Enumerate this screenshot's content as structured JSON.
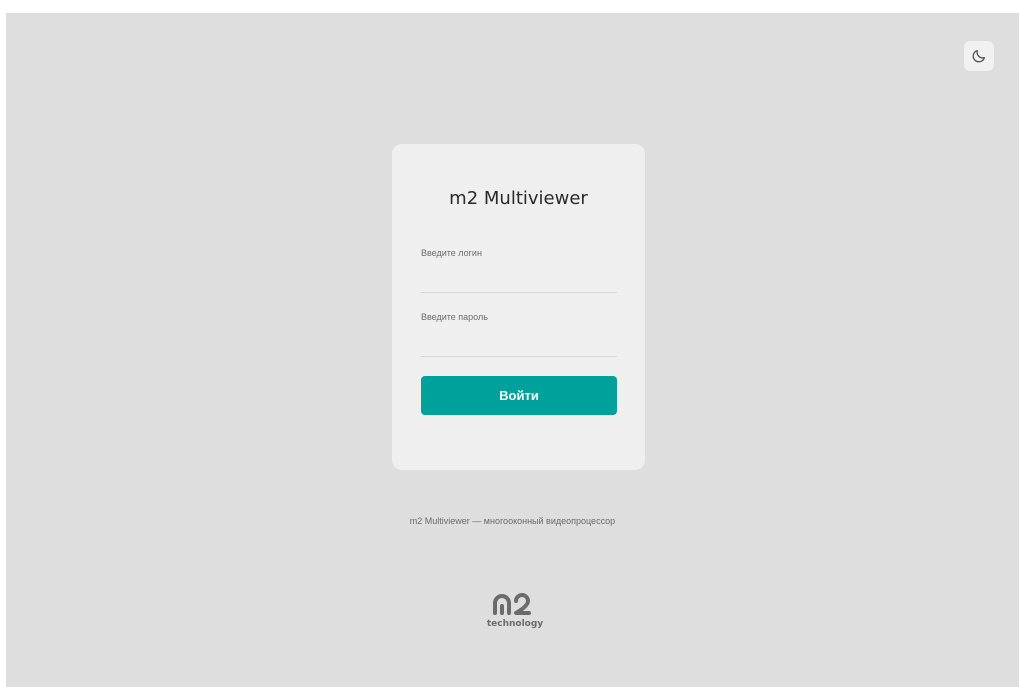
{
  "app": {
    "title": "m2 Multiviewer"
  },
  "header": {
    "theme_toggle_icon": "moon-icon"
  },
  "login_form": {
    "title": "m2 Multiviewer",
    "login_label": "Введите логин",
    "login_value": "",
    "password_label": "Введите пароль",
    "password_value": "",
    "submit_label": "Войти"
  },
  "footer": {
    "tagline": "m2 Multiviewer — многооконный видеопроцессор",
    "logo_mark": "m2",
    "logo_text": "technology"
  },
  "colors": {
    "background": "#dedede",
    "card": "#efefef",
    "accent": "#00a19a"
  }
}
